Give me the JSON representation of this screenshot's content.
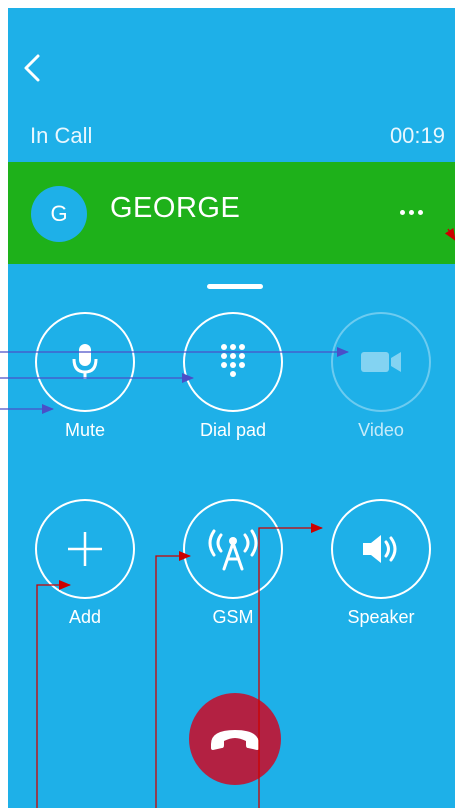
{
  "header": {
    "title": "In Call",
    "timer": "00:19"
  },
  "contact": {
    "initial": "G",
    "name": "GEORGE"
  },
  "controls": {
    "mute": "Mute",
    "dialpad": "Dial pad",
    "video": "Video",
    "add": "Add",
    "gsm": "GSM",
    "speaker": "Speaker"
  },
  "colors": {
    "background": "#1eb0e8",
    "contact_bar": "#1eb11a",
    "hangup": "#b32142",
    "annotation_blue": "#4a4fc8",
    "annotation_red": "#cc0000"
  },
  "icons": {
    "back": "back-chevron-icon",
    "more": "more-dots-icon",
    "mute": "microphone-icon",
    "dialpad": "dialpad-icon",
    "video": "video-camera-icon",
    "add": "plus-icon",
    "gsm": "antenna-icon",
    "speaker": "speaker-icon",
    "hangup": "phone-hangup-icon"
  }
}
